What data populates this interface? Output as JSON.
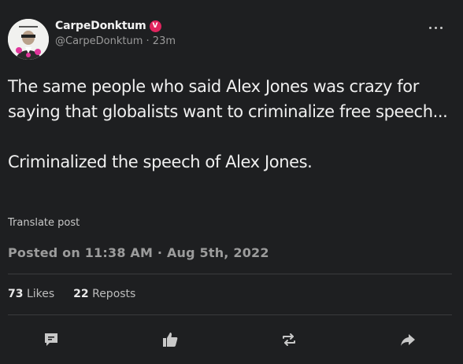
{
  "post": {
    "display_name": "CarpeDonktum",
    "verified_badge": "V",
    "handle": "@CarpeDonktum",
    "separator": "·",
    "time_ago": "23m",
    "paragraphs": [
      "The same people who said Alex Jones was crazy for saying that globalists want to criminalize free speech...",
      "Criminalized the speech of Alex Jones."
    ],
    "translate_label": "Translate post",
    "posted_label": "Posted on 11:38 AM · Aug 5th, 2022"
  },
  "stats": {
    "likes_count": "73",
    "likes_label": "Likes",
    "reposts_count": "22",
    "reposts_label": "Reposts"
  },
  "icons": {
    "more": "more-options-icon",
    "reply": "comment-icon",
    "like": "thumbs-up-icon",
    "repost": "repost-icon",
    "share": "share-icon",
    "verified": "verified-badge-icon"
  },
  "colors": {
    "background": "#1e1f21",
    "verified_badge": "#e0245e",
    "text_primary": "#f0f0f0",
    "text_secondary": "#9a9a9a"
  }
}
